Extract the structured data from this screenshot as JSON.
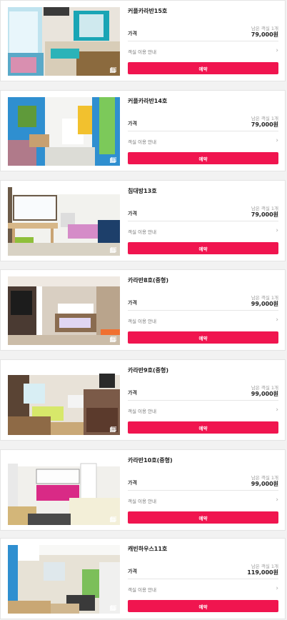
{
  "labels": {
    "price": "가격",
    "guide": "객실 이용 안내",
    "book": "예약",
    "remaining": "남은 객실 1개"
  },
  "colors": {
    "accent": "#f0154f",
    "card_border": "#e4e4e4",
    "background": "#f2f2f2"
  },
  "rooms": [
    {
      "name": "커플카라반15호",
      "price": "79,000원",
      "photo_icon": "gallery-icon"
    },
    {
      "name": "커플카라반14호",
      "price": "79,000원",
      "photo_icon": "gallery-icon"
    },
    {
      "name": "침대방13호",
      "price": "79,000원",
      "photo_icon": "gallery-icon"
    },
    {
      "name": "카라반8호(중형)",
      "price": "99,000원",
      "photo_icon": "gallery-icon"
    },
    {
      "name": "카라반9호(중형)",
      "price": "99,000원",
      "photo_icon": "gallery-icon"
    },
    {
      "name": "카라반10호(중형)",
      "price": "99,000원",
      "photo_icon": "gallery-icon"
    },
    {
      "name": "캐빈하우스11호",
      "price": "119,000원",
      "photo_icon": "gallery-icon"
    }
  ]
}
